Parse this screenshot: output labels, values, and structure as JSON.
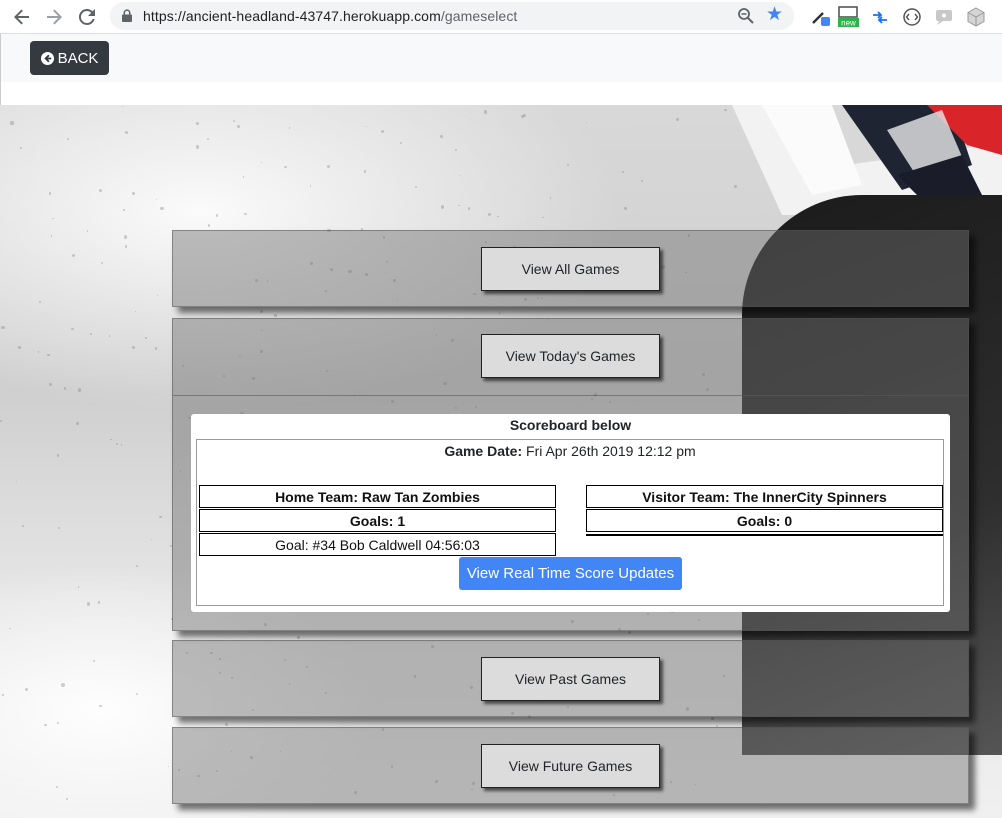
{
  "browser": {
    "url_host": "https://ancient-headland-43747.herokuapp.com",
    "url_path": "/gameselect",
    "extension_badge": "new"
  },
  "appbar": {
    "back_label": "BACK"
  },
  "sections": {
    "all_games_label": "View All Games",
    "todays_games_label": "View Today's Games",
    "past_games_label": "View Past Games",
    "future_games_label": "View Future Games"
  },
  "scoreboard": {
    "title": "Scoreboard below",
    "date_label": "Game Date:",
    "date_value": " Fri Apr 26th 2019 12:12 pm",
    "home_team": "Home Team: Raw Tan Zombies",
    "home_goals": "Goals: 1",
    "home_goal_detail": "Goal: #34 Bob Caldwell 04:56:03",
    "visitor_team": "Visitor Team: The InnerCity Spinners",
    "visitor_goals": "Goals: 0",
    "realtime_button": "View Real Time Score Updates"
  },
  "colors": {
    "primary_button": "#4285f4",
    "back_button": "#343a40",
    "chrome_star": "#4285f4"
  }
}
